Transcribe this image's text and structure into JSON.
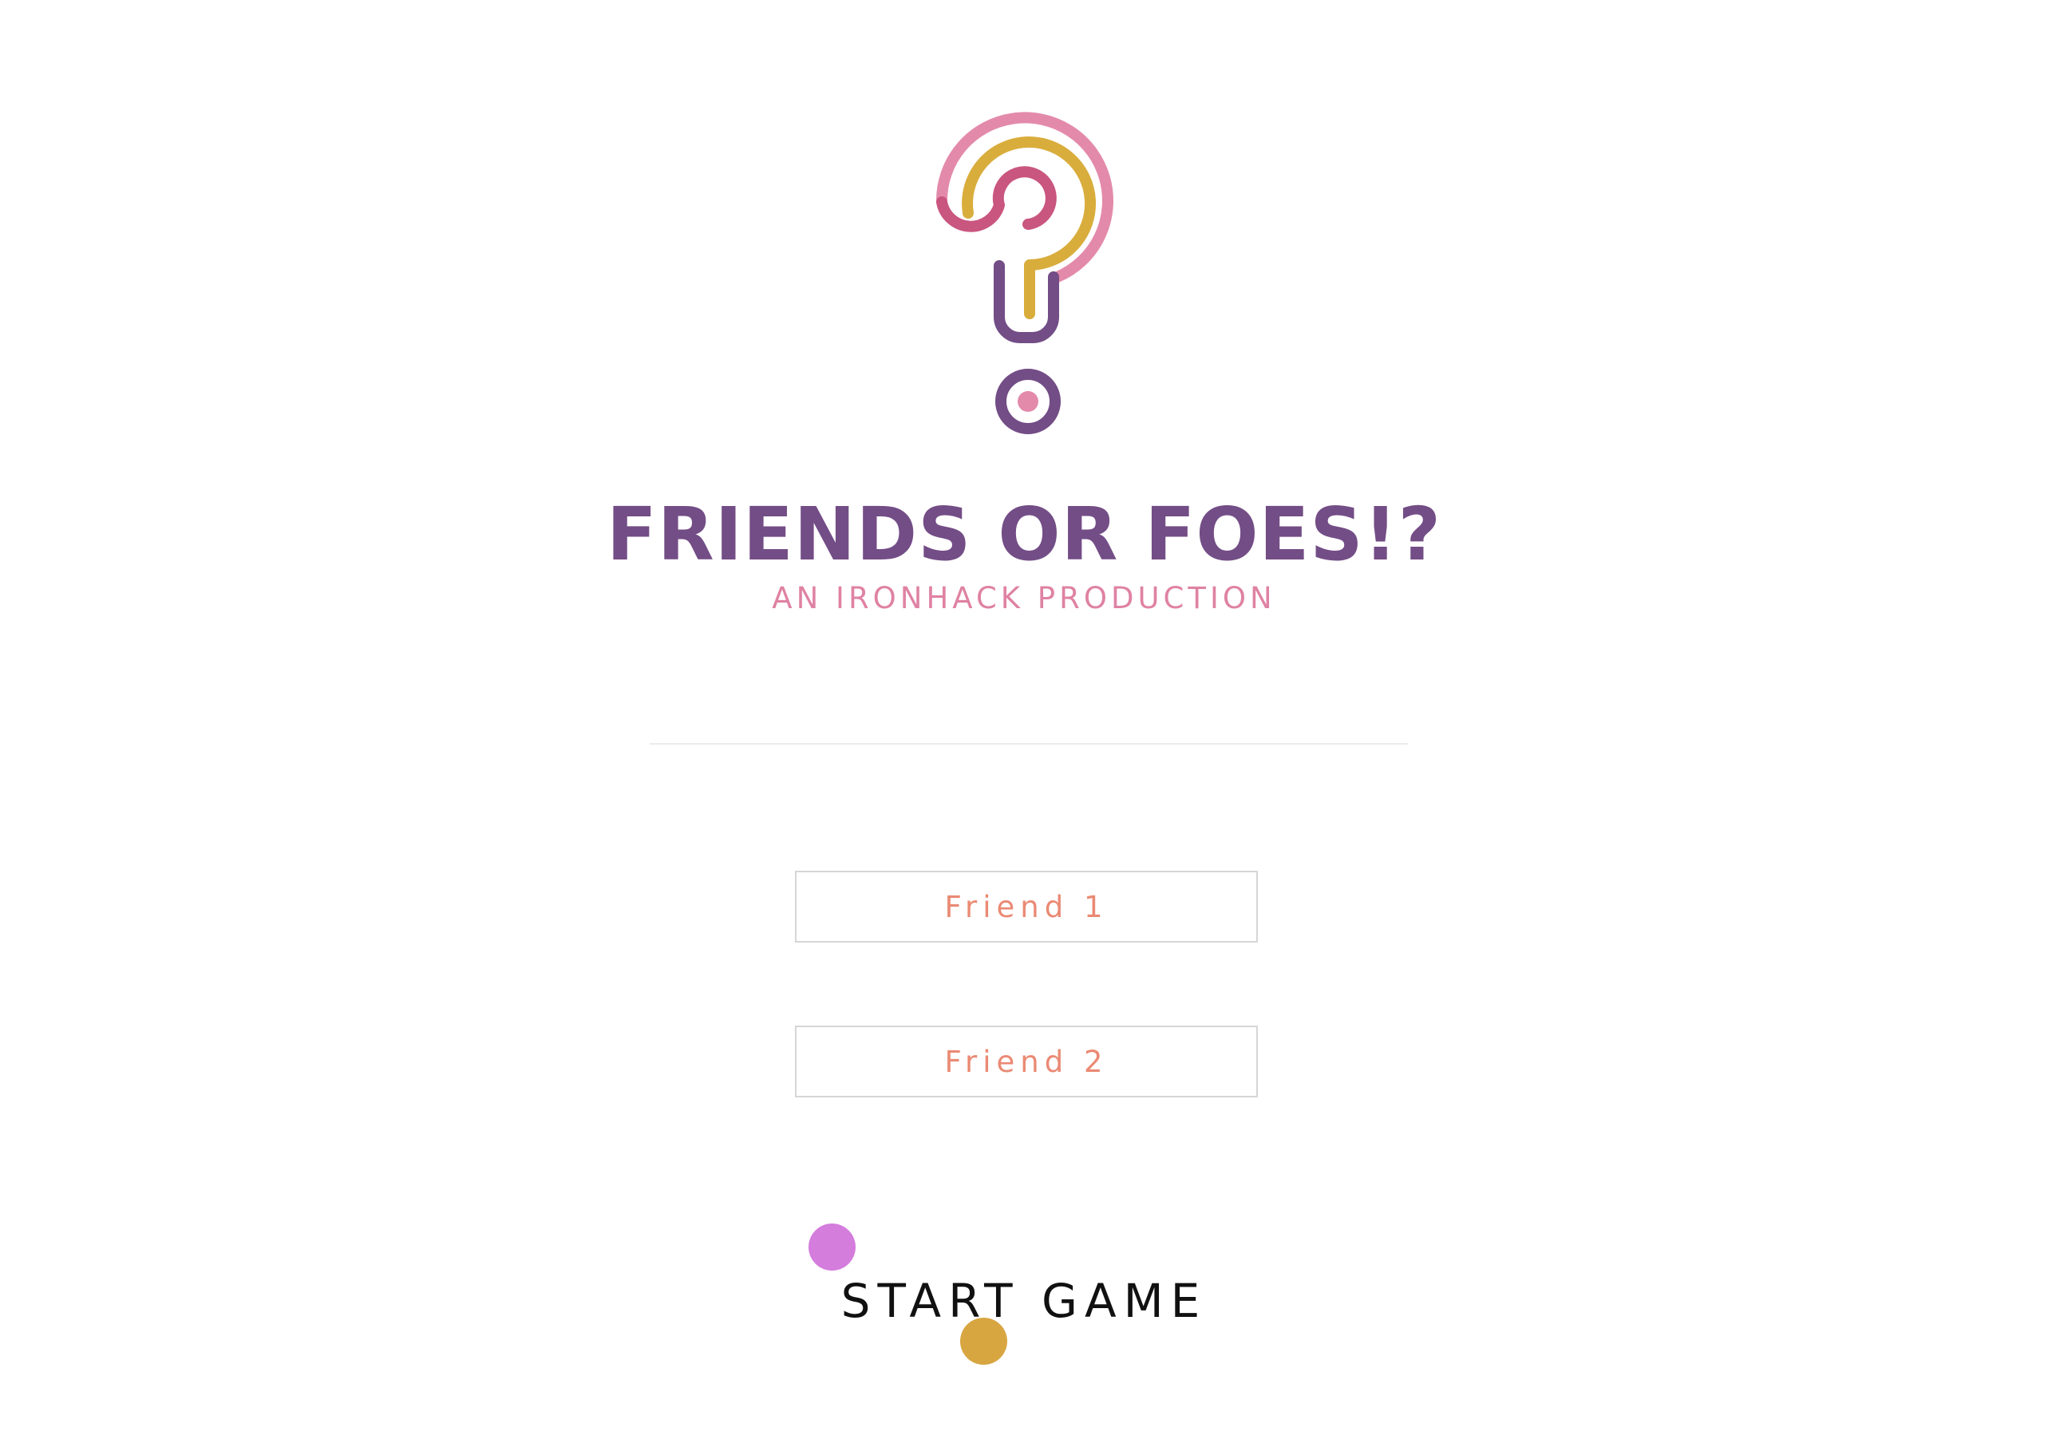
{
  "app": {
    "title": "FRIENDS OR FOES!?",
    "subtitle": "AN IRONHACK PRODUCTION"
  },
  "logo": {
    "icon": "question-mark-logo",
    "colors": {
      "outer": "#e38aaa",
      "middle": "#d9ad3c",
      "inner": "#c9567f",
      "stem": "#734d86",
      "dot_center": "#e38aaa"
    }
  },
  "form": {
    "friend1_placeholder": "Friend 1",
    "friend2_placeholder": "Friend 2",
    "start_label": "START GAME"
  },
  "colors": {
    "title": "#734d86",
    "subtitle": "#df82a3",
    "input_text": "#ea8a74",
    "start_text": "#111111",
    "dot_pink": "#d47ddd",
    "dot_gold": "#d8a641"
  }
}
